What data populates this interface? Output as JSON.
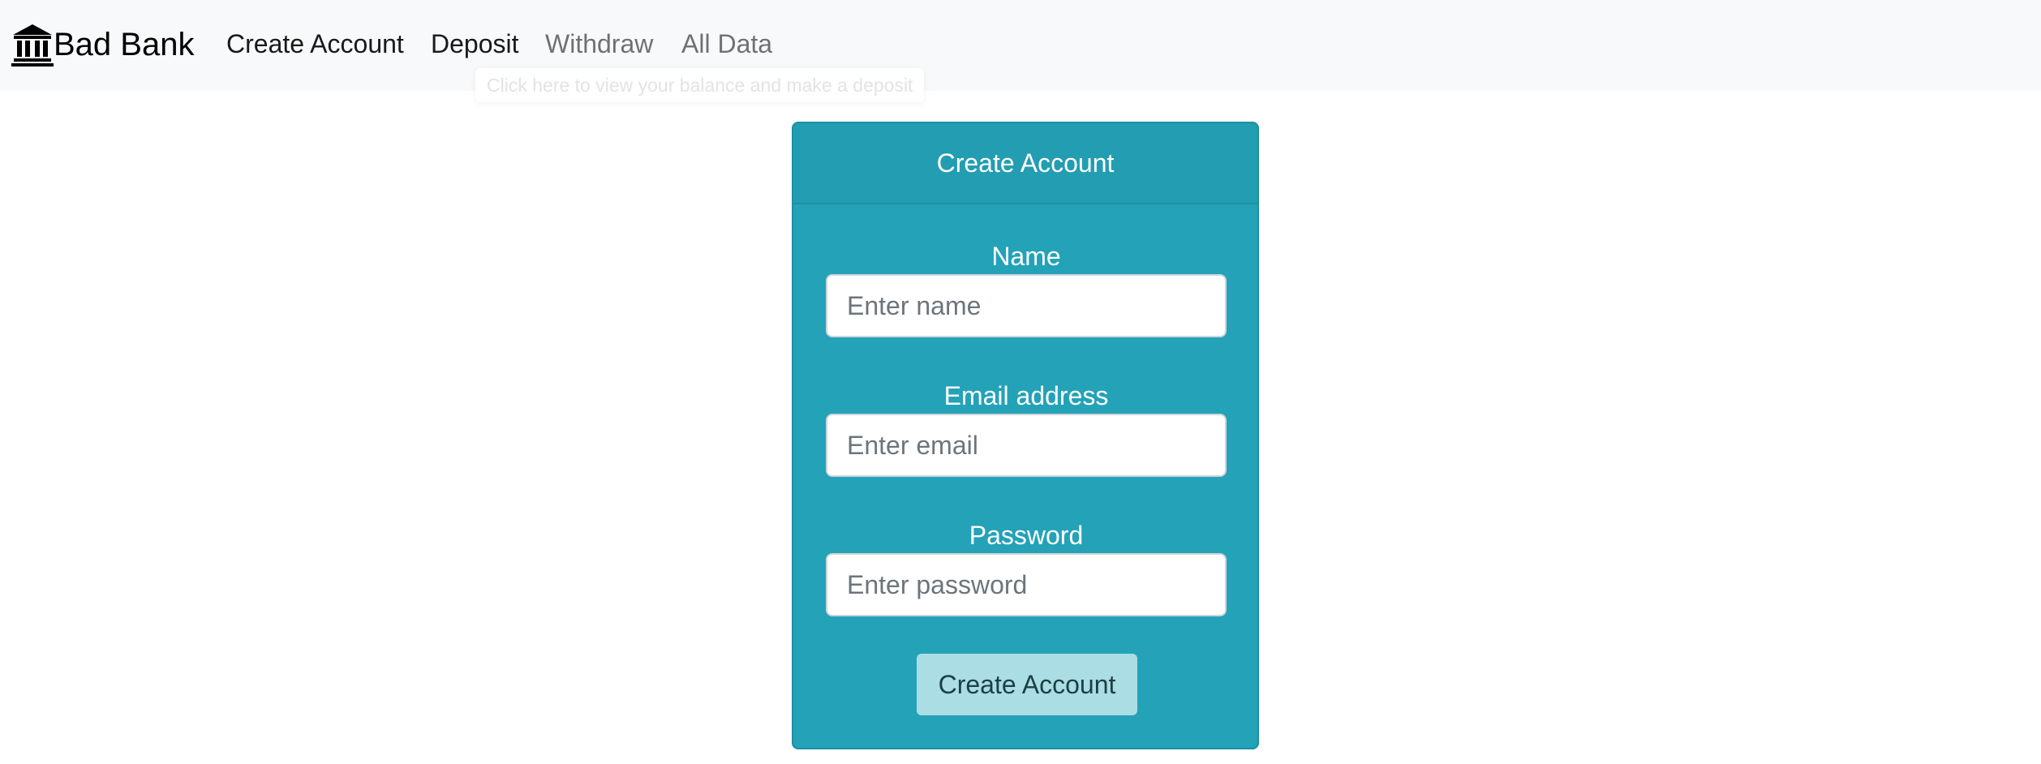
{
  "navbar": {
    "brand_icon": "bank-building-icon",
    "brand_label": "Bad Bank",
    "links": [
      {
        "label": "Create Account",
        "state": "normal"
      },
      {
        "label": "Deposit",
        "state": "hover"
      },
      {
        "label": "Withdraw",
        "state": "normal"
      },
      {
        "label": "All Data",
        "state": "normal"
      }
    ],
    "tooltip": "Click here to view your balance and make a deposit"
  },
  "card": {
    "title": "Create Account",
    "fields": {
      "name": {
        "label": "Name",
        "placeholder": "Enter name",
        "value": ""
      },
      "email": {
        "label": "Email address",
        "placeholder": "Enter email",
        "value": ""
      },
      "password": {
        "label": "Password",
        "placeholder": "Enter password",
        "value": ""
      }
    },
    "submit_label": "Create Account"
  },
  "colors": {
    "navbar_bg": "#f8f9fa",
    "card_bg": "#23a2b8",
    "button_bg": "#aadde4"
  }
}
